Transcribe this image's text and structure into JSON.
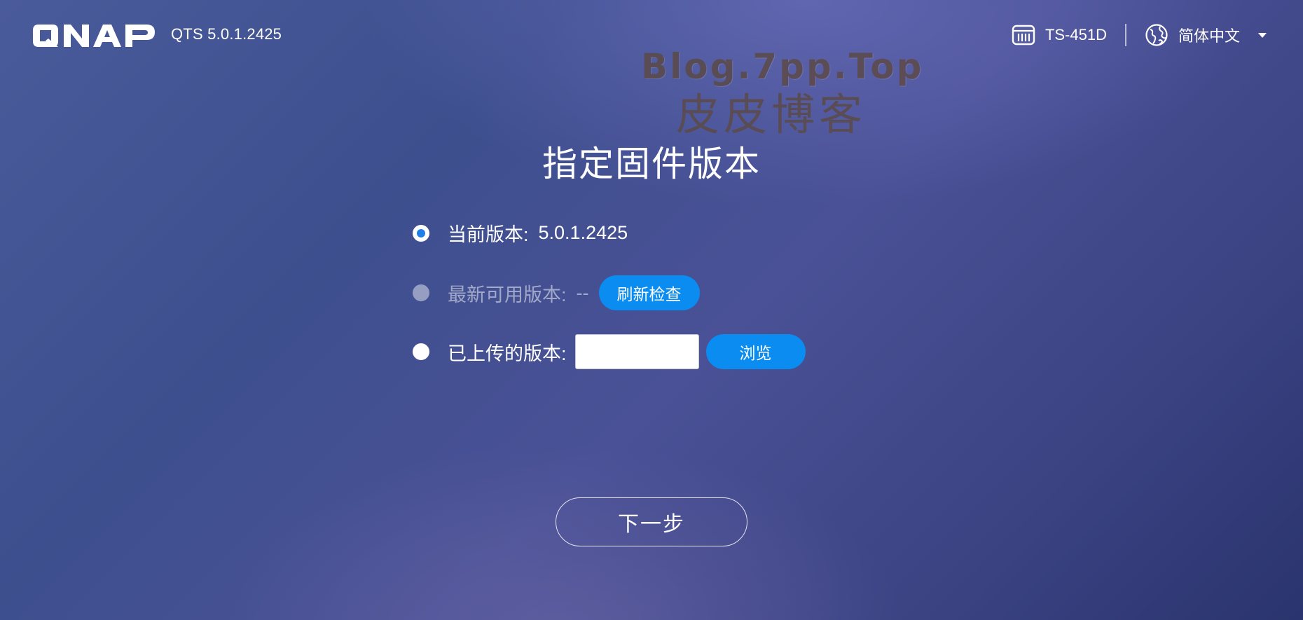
{
  "header": {
    "brand": "QNAP",
    "os_version": "QTS 5.0.1.2425",
    "model_name": "TS-451D",
    "language": "简体中文"
  },
  "watermark": {
    "line1": "Blog.7pp.Top",
    "line2": "皮皮博客"
  },
  "main": {
    "title": "指定固件版本",
    "options": [
      {
        "label": "当前版本:",
        "value": "5.0.1.2425",
        "selected": true,
        "enabled": true
      },
      {
        "label": "最新可用版本:",
        "value": "--",
        "selected": false,
        "enabled": false,
        "button_label": "刷新检查"
      },
      {
        "label": "已上传的版本:",
        "selected": false,
        "enabled": true,
        "file_input_value": "",
        "button_label": "浏览"
      }
    ],
    "next_label": "下一步"
  },
  "colors": {
    "accent": "#0a8cf0",
    "radio_selected": "#1f7fe6",
    "background_start": "#4a5b9b",
    "background_end": "#2a346d"
  },
  "icons": {
    "model": "nas-device-icon",
    "language": "globe-icon",
    "dropdown": "caret-down-icon"
  }
}
